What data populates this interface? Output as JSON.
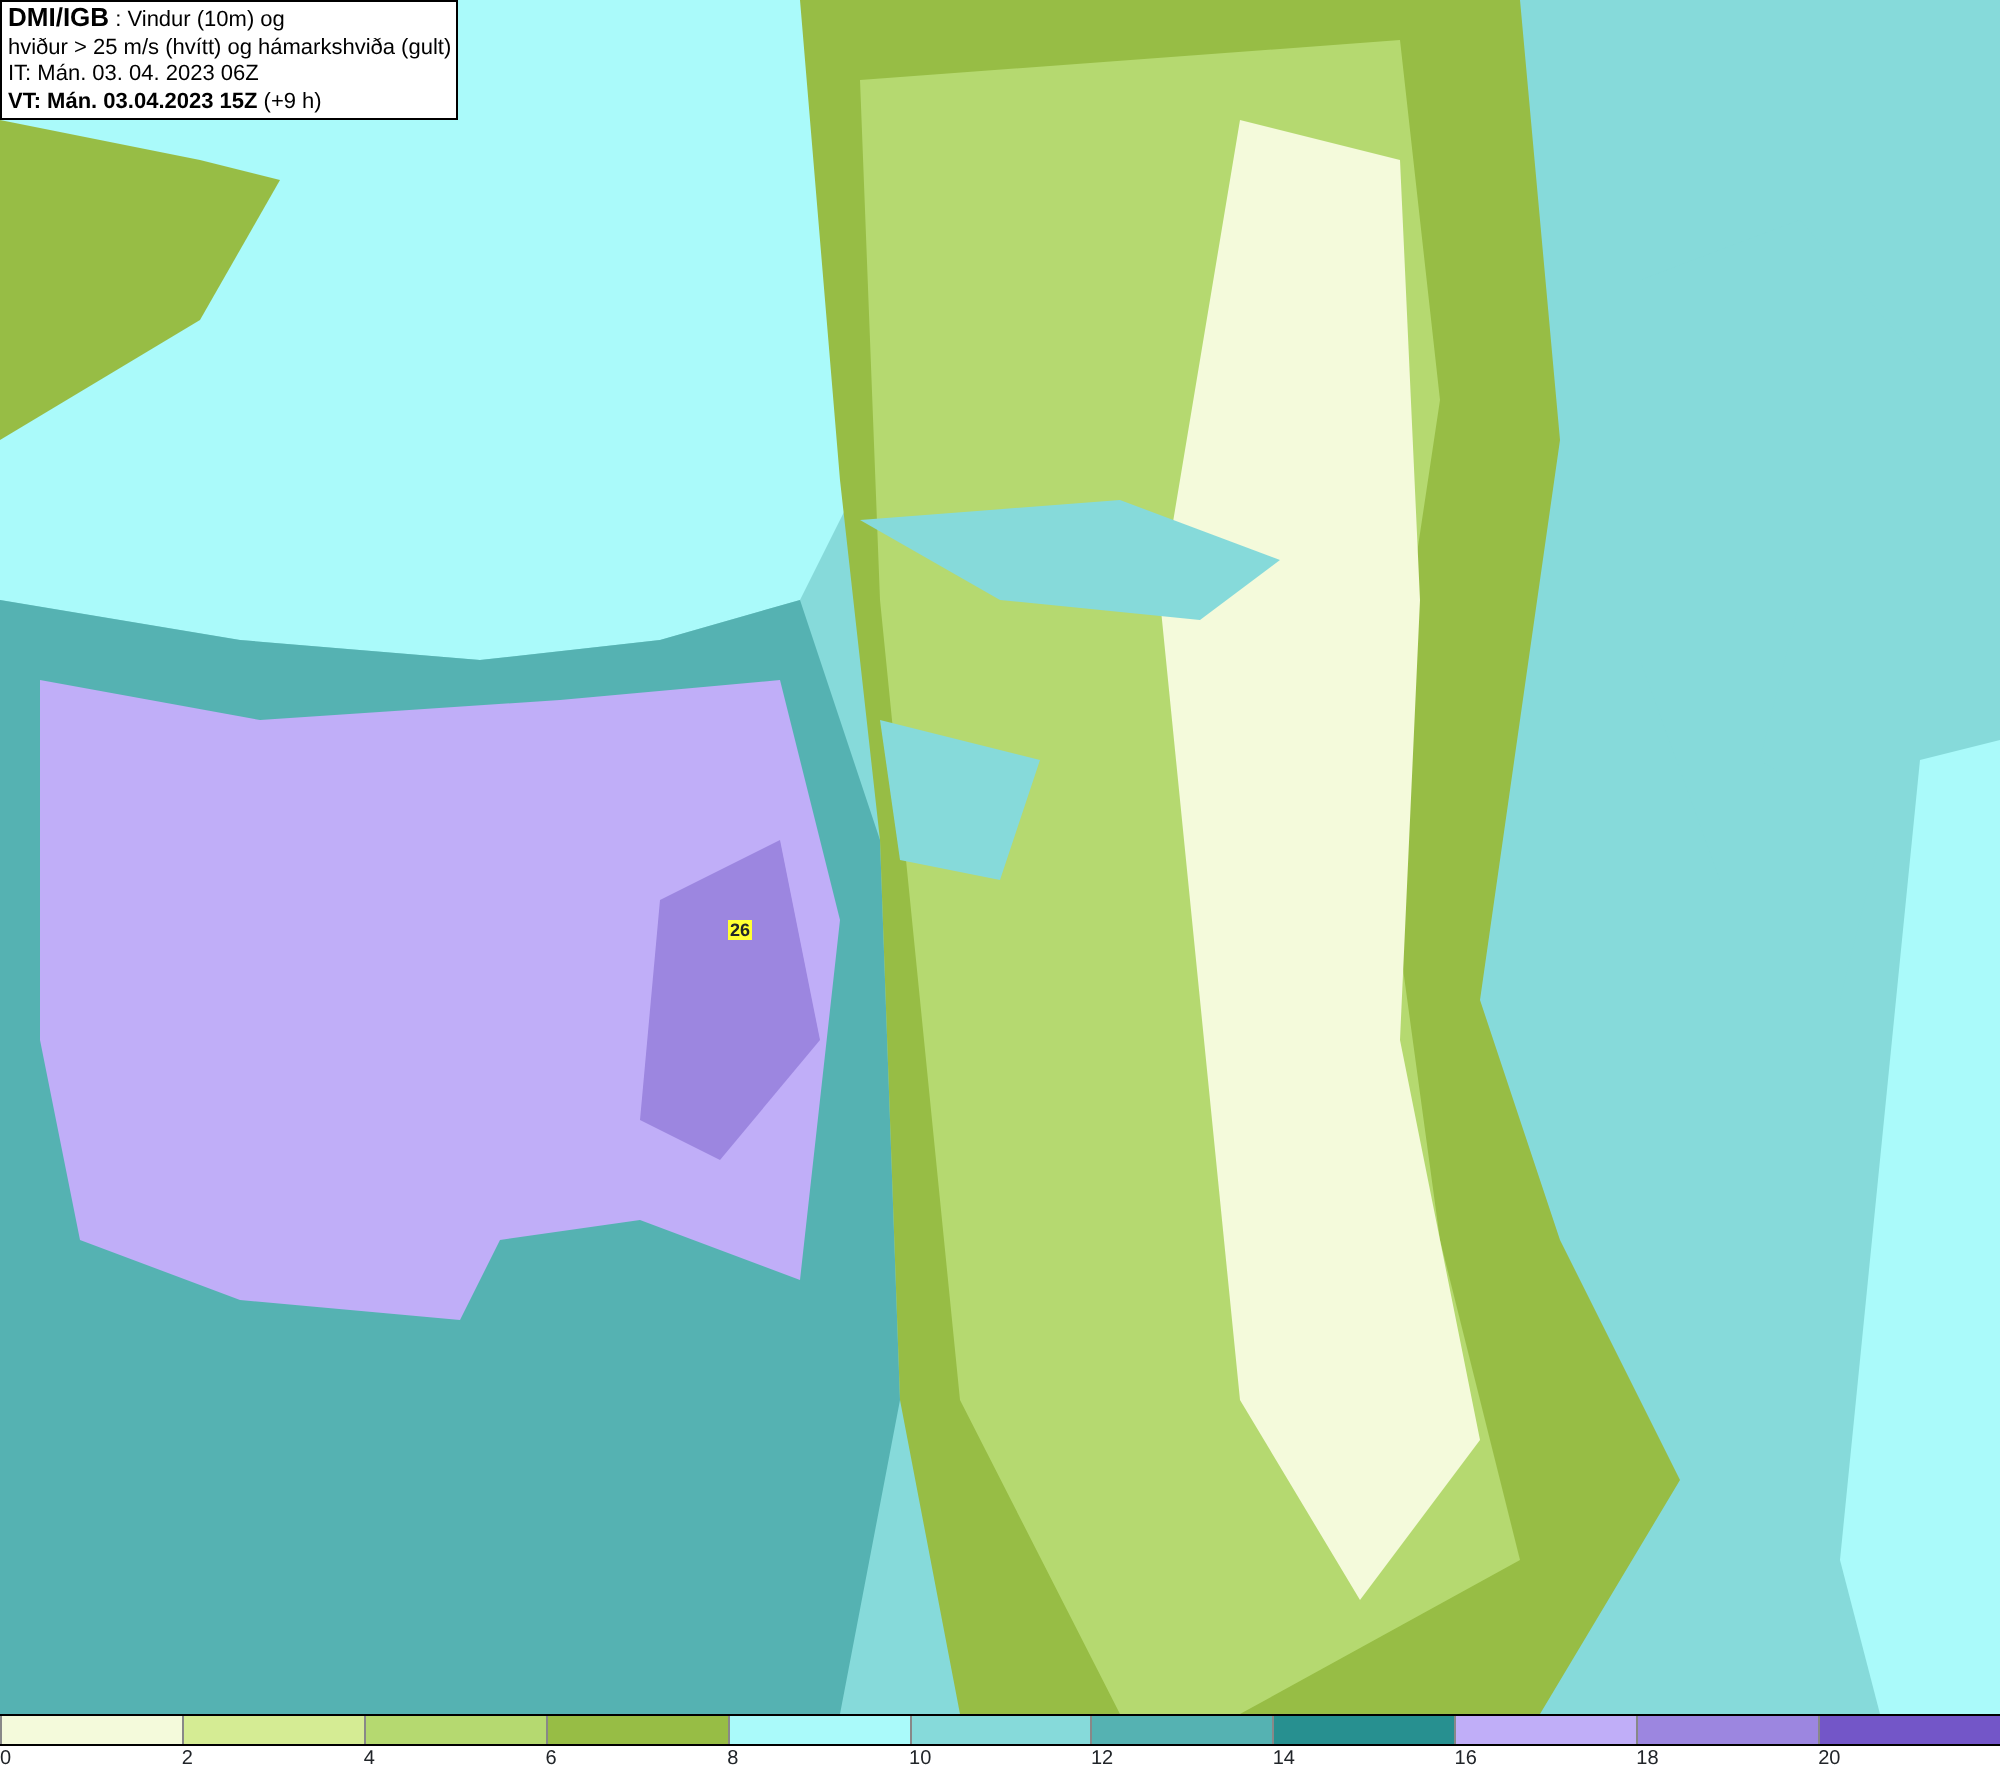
{
  "title_box": {
    "lines": [
      "**DMI/IGB** : Vindur (10m) og",
      "hviður > 25 m/s (hvítt) og hámarkshviða (gult)",
      "IT: Mán. 03. 04. 2023 06Z",
      "**VT: Mán. 03.04.2023 15Z** (+9 h)"
    ]
  },
  "map": {
    "gust_label": "26"
  },
  "legend": {
    "bins": [
      {
        "color": "#f4fadb",
        "label": "0"
      },
      {
        "color": "#d5ec94",
        "label": "2"
      },
      {
        "color": "#b5d970",
        "label": "4"
      },
      {
        "color": "#97bd45",
        "label": "6"
      },
      {
        "color": "#aafafa",
        "label": "8"
      },
      {
        "color": "#86dada",
        "label": "10"
      },
      {
        "color": "#55b2b2",
        "label": "12"
      },
      {
        "color": "#279090",
        "label": "14"
      },
      {
        "color": "#c0aef8",
        "label": "16"
      },
      {
        "color": "#9c86e0",
        "label": "18"
      },
      {
        "color": "#7356c8",
        "label": "20"
      }
    ]
  }
}
